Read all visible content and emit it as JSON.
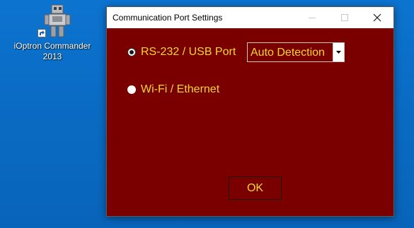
{
  "desktop": {
    "icon": {
      "name": "robot-app-icon",
      "label_line1": "iOptron Commander",
      "label_line2": "2013"
    }
  },
  "dialog": {
    "title": "Communication Port Settings",
    "options": [
      {
        "label": "RS-232 / USB Port",
        "selected": true
      },
      {
        "label": "Wi-Fi / Ethernet",
        "selected": false
      }
    ],
    "port_select": {
      "value": "Auto Detection"
    },
    "ok_label": "OK"
  },
  "colors": {
    "dialog_background": "#7a0000",
    "label_text": "#f2d730",
    "desktop_background": "#0a6ec9"
  }
}
